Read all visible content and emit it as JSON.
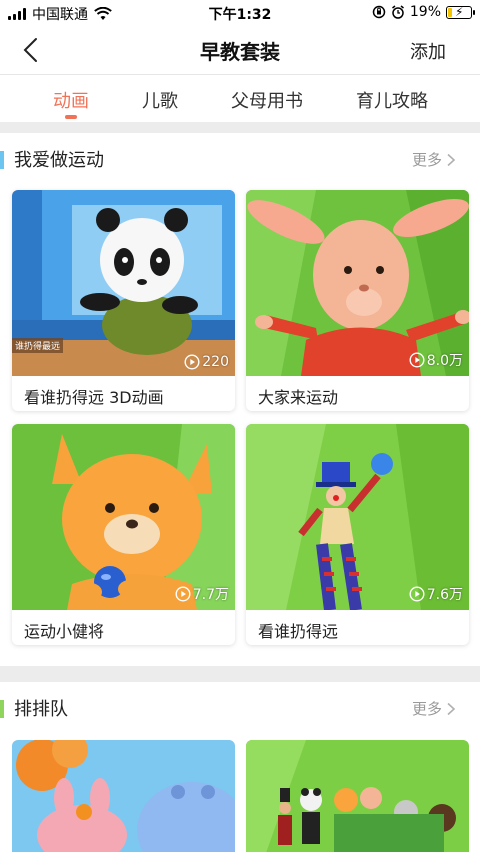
{
  "status_bar": {
    "carrier": "中国联通",
    "time": "下午1:32",
    "battery_percent": "19%",
    "battery_level": 0.19
  },
  "nav": {
    "title": "早教套装",
    "add_label": "添加"
  },
  "tabs": [
    {
      "label": "动画",
      "active": true
    },
    {
      "label": "儿歌",
      "active": false
    },
    {
      "label": "父母用书",
      "active": false
    },
    {
      "label": "育儿攻略",
      "active": false
    }
  ],
  "sections": [
    {
      "title": "我爱做运动",
      "more": "更多",
      "accent": "#6cc4f0",
      "cards": [
        {
          "title": "看谁扔得远 3D动画",
          "plays": "220",
          "badge": "谁扔得最远"
        },
        {
          "title": "大家来运动",
          "plays": "8.0万"
        },
        {
          "title": "运动小健将",
          "plays": "7.7万"
        },
        {
          "title": "看谁扔得远",
          "plays": "7.6万"
        }
      ]
    },
    {
      "title": "排排队",
      "more": "更多",
      "accent": "#8fd45c"
    }
  ],
  "colors": {
    "accent": "#f07358",
    "text": "#222222",
    "muted": "#9a9a9a"
  }
}
